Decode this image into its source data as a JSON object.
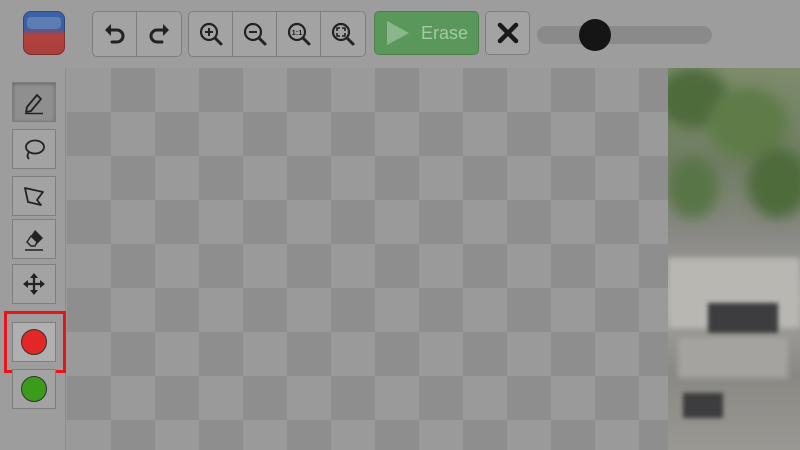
{
  "toolbar": {
    "history": [
      "undo",
      "redo"
    ],
    "zoom": [
      "zoom-in",
      "zoom-out",
      "zoom-actual-size",
      "zoom-fit"
    ],
    "zoom_actual_label": "1:1",
    "erase_label": "Erase",
    "brush_size_fraction": 0.33
  },
  "tools": [
    {
      "name": "pencil"
    },
    {
      "name": "lasso"
    },
    {
      "name": "polygon-lasso"
    },
    {
      "name": "eraser"
    },
    {
      "name": "move"
    },
    {
      "name": "red-marker",
      "color": "#e32626"
    },
    {
      "name": "green-marker",
      "color": "#3b9b1a"
    }
  ],
  "colors": {
    "accent_erase": "#5a975a",
    "highlight": "#e8141a",
    "red_marker": "#e32626",
    "green_marker": "#3b9b1a"
  }
}
